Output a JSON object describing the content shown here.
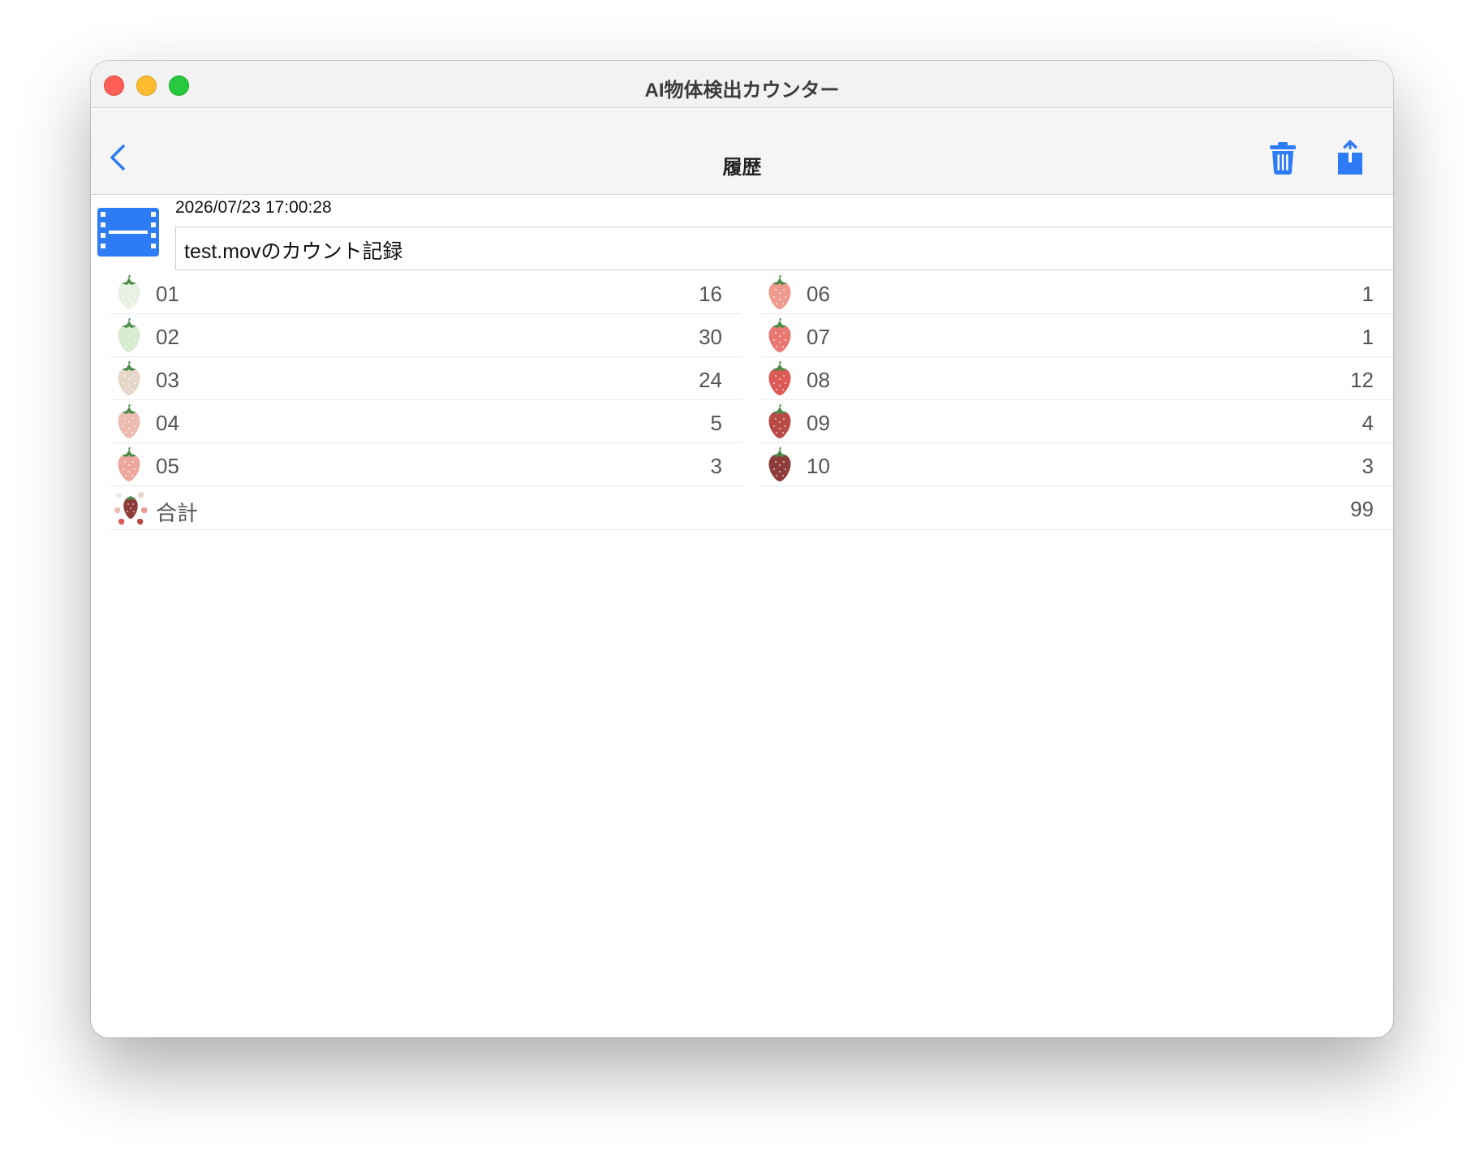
{
  "window": {
    "title": "AI物体検出カウンター"
  },
  "navbar": {
    "title": "履歴",
    "back_icon": "chevron-left-icon",
    "trash_icon": "trash-icon",
    "share_icon": "share-icon"
  },
  "colors": {
    "accent": "#2d7cf6",
    "text": "#555555"
  },
  "record": {
    "timestamp": "2026/07/23 17:00:28",
    "title": "test.movのカウント記録",
    "icon": "film-icon"
  },
  "counts_left": [
    {
      "label": "01",
      "count": "16",
      "color": "#e8f0e4"
    },
    {
      "label": "02",
      "count": "30",
      "color": "#d6ebd0"
    },
    {
      "label": "03",
      "count": "24",
      "color": "#e6d6c8"
    },
    {
      "label": "04",
      "count": "5",
      "color": "#ecbcb0"
    },
    {
      "label": "05",
      "count": "3",
      "color": "#eca89c"
    }
  ],
  "counts_right": [
    {
      "label": "06",
      "count": "1",
      "color": "#ee9a8e"
    },
    {
      "label": "07",
      "count": "1",
      "color": "#e87874"
    },
    {
      "label": "08",
      "count": "12",
      "color": "#dc5a56"
    },
    {
      "label": "09",
      "count": "4",
      "color": "#b84a46"
    },
    {
      "label": "10",
      "count": "3",
      "color": "#8e3c3a"
    }
  ],
  "total": {
    "label": "合計",
    "count": "99"
  }
}
